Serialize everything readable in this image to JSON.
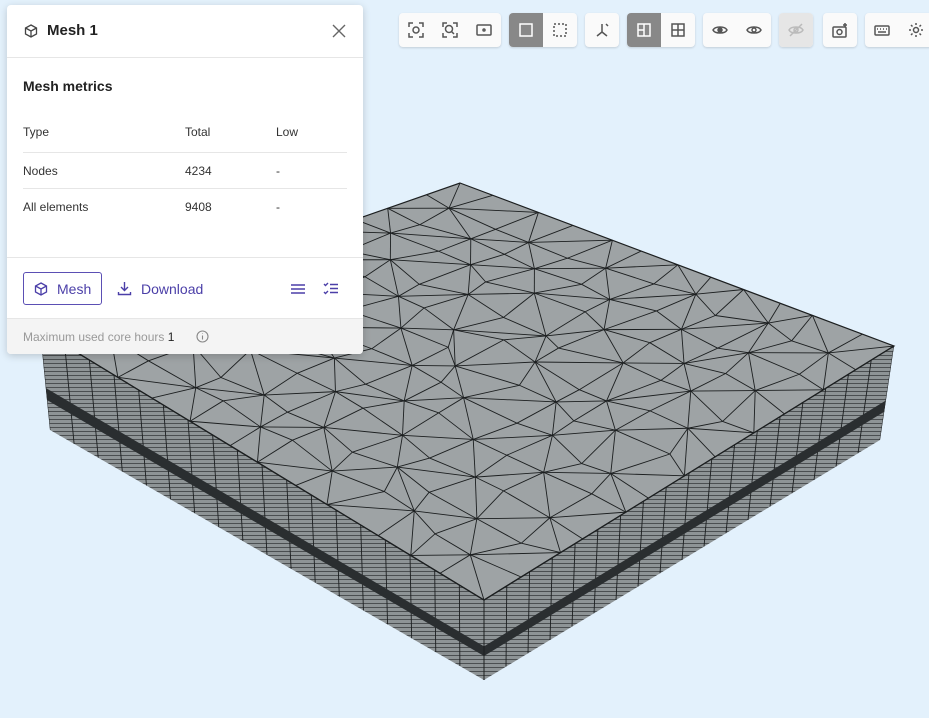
{
  "panel": {
    "title": "Mesh 1",
    "section_title": "Mesh metrics",
    "columns": [
      "Type",
      "Total",
      "Low"
    ],
    "rows": [
      {
        "type": "Nodes",
        "total": "4234",
        "low": "-"
      },
      {
        "type": "All elements",
        "total": "9408",
        "low": "-"
      }
    ],
    "mesh_button": "Mesh",
    "download_button": "Download",
    "footer_label": "Maximum used core hours",
    "footer_value": "1"
  },
  "toolbar": {
    "groups": [
      {
        "name": "view",
        "buttons": [
          "fit-selection-icon",
          "zoom-fit-icon",
          "zoom-box-icon"
        ]
      },
      {
        "name": "render",
        "buttons": [
          "solid-view-icon",
          "wireframe-view-icon"
        ],
        "active": "solid-view-icon"
      },
      {
        "name": "axes",
        "buttons": [
          "axes-icon"
        ]
      },
      {
        "name": "section",
        "buttons": [
          "section-view-icon",
          "grid-view-icon"
        ],
        "active": "section-view-icon"
      },
      {
        "name": "visibility",
        "buttons": [
          "hide-icon",
          "show-icon"
        ]
      },
      {
        "name": "visibility-extra",
        "buttons": [
          "hidden-toggle-icon"
        ],
        "disabled": "hidden-toggle-icon"
      },
      {
        "name": "capture",
        "buttons": [
          "screenshot-icon"
        ]
      },
      {
        "name": "settings",
        "buttons": [
          "keyboard-icon",
          "gear-icon"
        ]
      }
    ]
  },
  "colors": {
    "background": "#e3f1fc",
    "mesh_face": "#9ea3a5",
    "mesh_lines": "#1c1f20",
    "accent": "#4b3fa8"
  }
}
